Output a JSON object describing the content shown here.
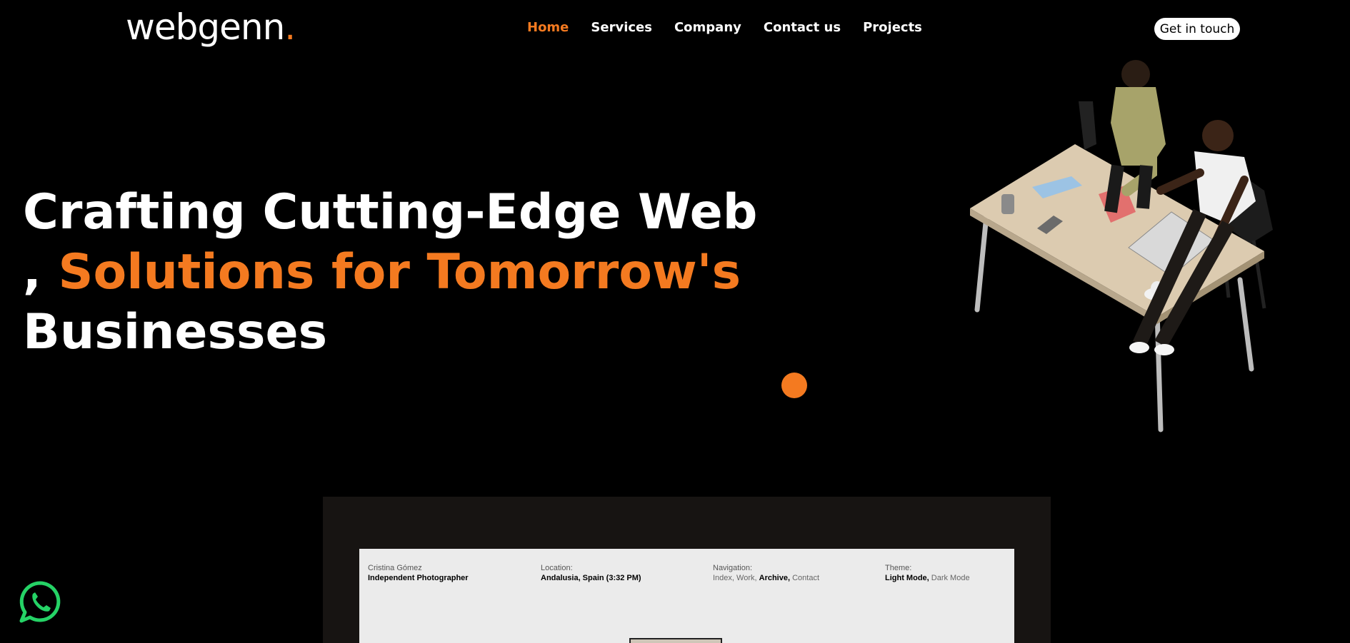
{
  "brand": {
    "name": "webgenn",
    "dot": "."
  },
  "nav": {
    "items": [
      {
        "label": "Home",
        "active": true
      },
      {
        "label": "Services",
        "active": false
      },
      {
        "label": "Company",
        "active": false
      },
      {
        "label": "Contact us",
        "active": false
      },
      {
        "label": "Projects",
        "active": false
      }
    ],
    "cta": "Get in touch"
  },
  "hero": {
    "line1": "Crafting Cutting-Edge Web",
    "line2_prefix": ", ",
    "line2_accent": "Solutions for Tomorrow's",
    "line3": "Businesses"
  },
  "preview": {
    "col1": {
      "label": "Cristina Gómez",
      "value": "Independent Photographer"
    },
    "col2": {
      "label": "Location:",
      "value": "Andalusia, Spain (3:32 PM)"
    },
    "col3": {
      "label": "Navigation:",
      "items": [
        "Index,",
        "Work,",
        "Archive,",
        "Contact"
      ]
    },
    "col4": {
      "label": "Theme:",
      "items": [
        "Light Mode,",
        "Dark Mode"
      ]
    }
  },
  "colors": {
    "accent": "#f47a20",
    "background": "#000000",
    "whatsapp": "#25d366"
  },
  "icons": {
    "whatsapp": "whatsapp-icon"
  }
}
